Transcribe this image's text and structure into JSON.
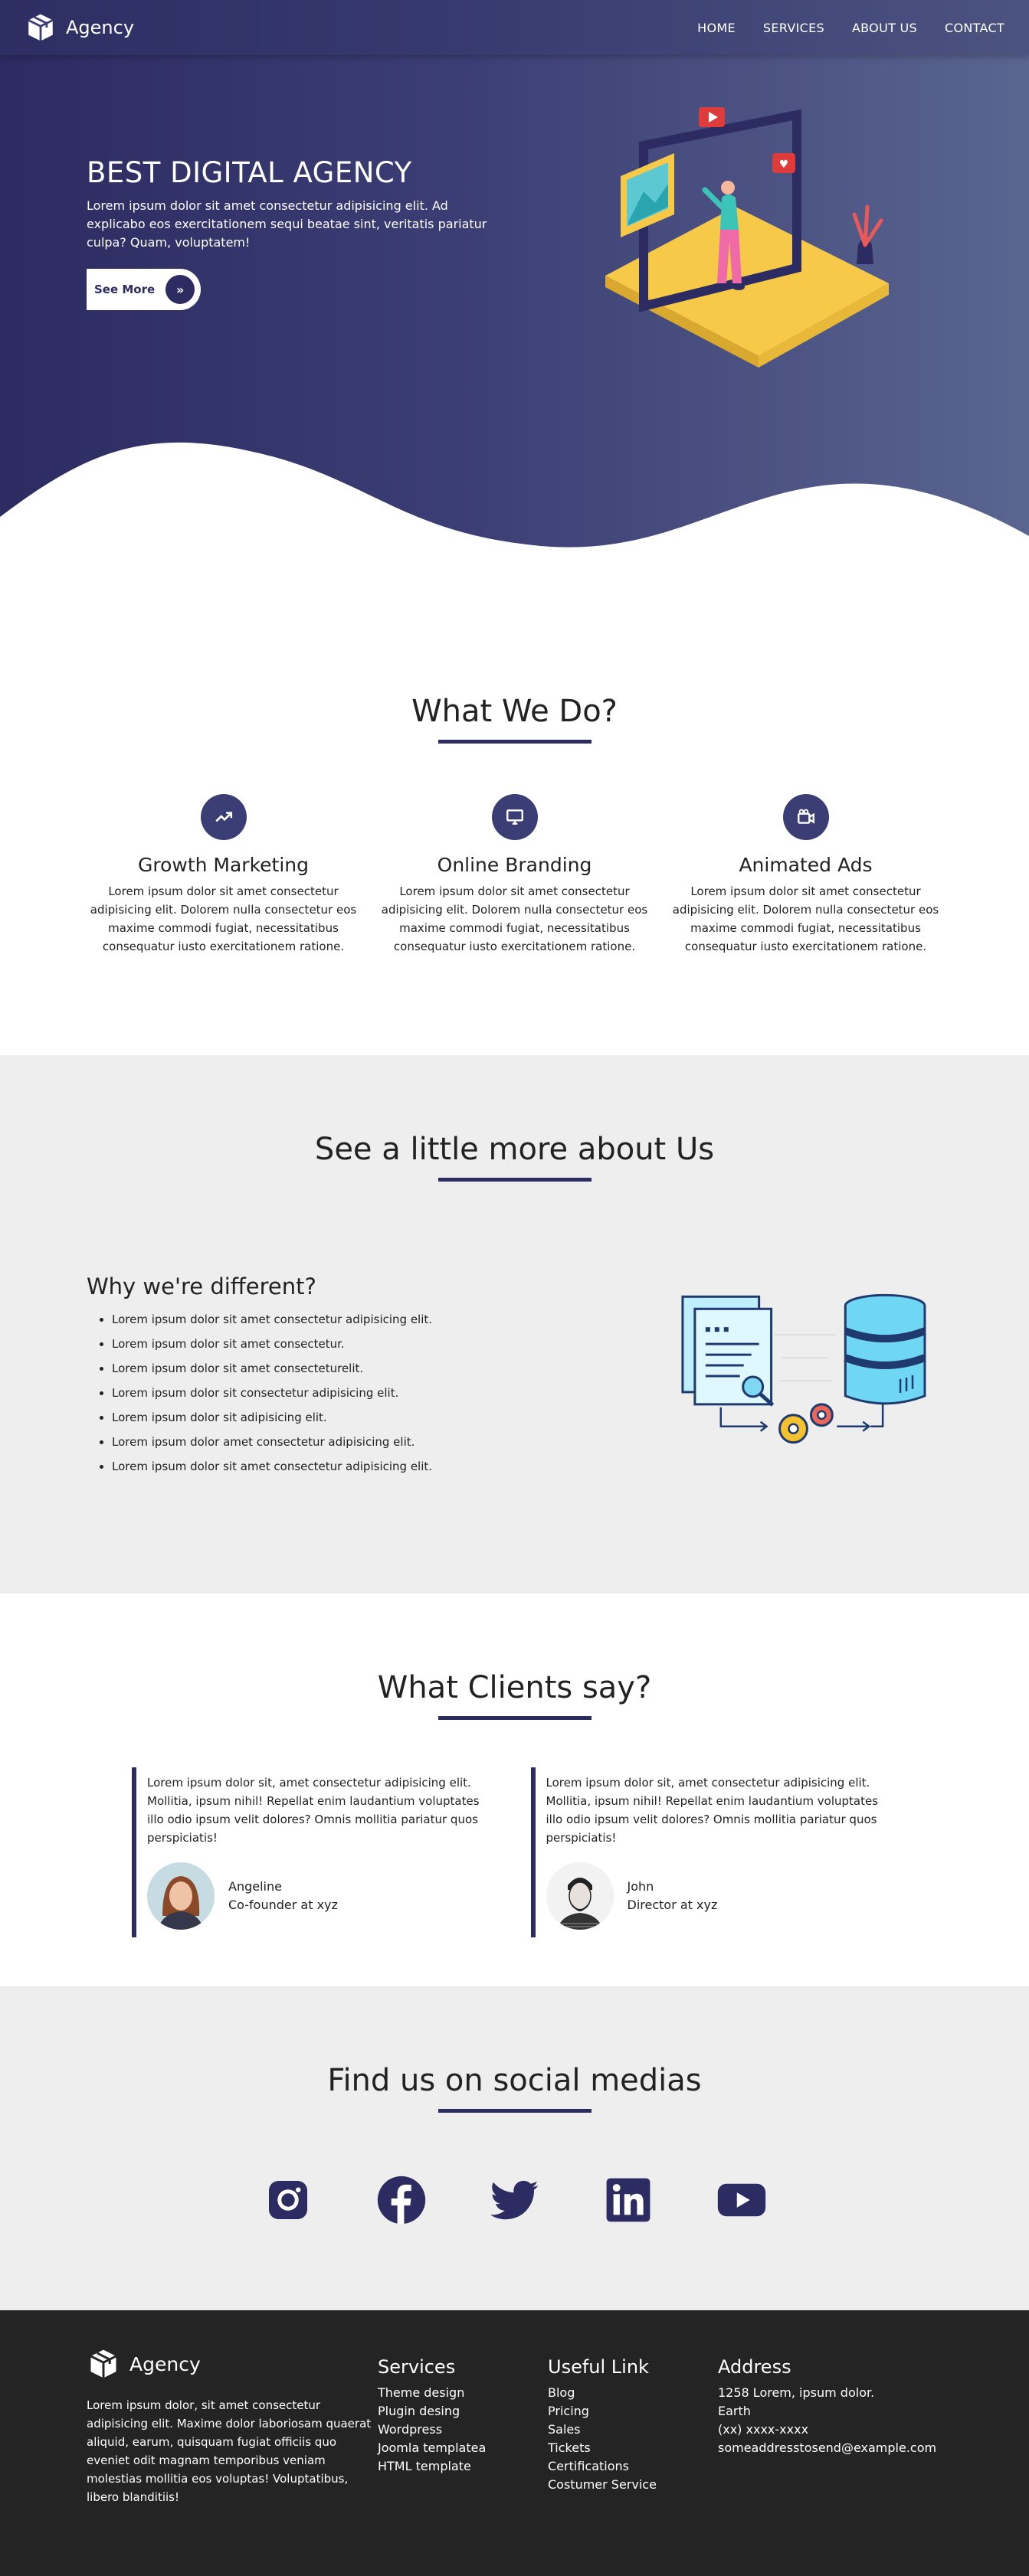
{
  "nav": {
    "brand": "Agency",
    "items": [
      "HOME",
      "SERVICES",
      "ABOUT US",
      "CONTACT"
    ]
  },
  "hero": {
    "title": "BEST DIGITAL AGENCY",
    "text": "Lorem ipsum dolor sit amet consectetur adipisicing elit. Ad explicabo eos exercitationem sequi beatae sint, veritatis pariatur culpa? Quam, voluptatem!",
    "button": "See More"
  },
  "services": {
    "title": "What We Do?",
    "items": [
      {
        "title": "Growth Marketing",
        "text": "Lorem ipsum dolor sit amet consectetur adipisicing elit. Dolorem nulla consectetur eos maxime commodi fugiat, necessitatibus consequatur iusto exercitationem ratione.",
        "icon": "trending-up-icon"
      },
      {
        "title": "Online Branding",
        "text": "Lorem ipsum dolor sit amet consectetur adipisicing elit. Dolorem nulla consectetur eos maxime commodi fugiat, necessitatibus consequatur iusto exercitationem ratione.",
        "icon": "desktop-icon"
      },
      {
        "title": "Animated Ads",
        "text": "Lorem ipsum dolor sit amet consectetur adipisicing elit. Dolorem nulla consectetur eos maxime commodi fugiat, necessitatibus consequatur iusto exercitationem ratione.",
        "icon": "video-camera-icon"
      }
    ]
  },
  "about": {
    "title": "See a little more about Us",
    "subtitle": "Why we're different?",
    "list": [
      "Lorem ipsum dolor sit amet consectetur adipisicing elit.",
      "Lorem ipsum dolor sit amet consectetur.",
      "Lorem ipsum dolor sit amet consecteturelit.",
      "Lorem ipsum dolor sit consectetur adipisicing elit.",
      "Lorem ipsum dolor sit adipisicing elit.",
      "Lorem ipsum dolor amet consectetur adipisicing elit.",
      "Lorem ipsum dolor sit amet consectetur adipisicing elit."
    ]
  },
  "clients": {
    "title": "What Clients say?",
    "items": [
      {
        "text": "Lorem ipsum dolor sit, amet consectetur adipisicing elit. Mollitia, ipsum nihil! Repellat enim laudantium voluptates illo odio ipsum velit dolores? Omnis mollitia pariatur quos perspiciatis!",
        "name": "Angeline",
        "role": "Co-founder at xyz"
      },
      {
        "text": "Lorem ipsum dolor sit, amet consectetur adipisicing elit. Mollitia, ipsum nihil! Repellat enim laudantium voluptates illo odio ipsum velit dolores? Omnis mollitia pariatur quos perspiciatis!",
        "name": "John",
        "role": "Director at xyz"
      }
    ]
  },
  "social": {
    "title": "Find us on social medias",
    "icons": [
      "instagram-icon",
      "facebook-icon",
      "twitter-icon",
      "linkedin-icon",
      "youtube-icon"
    ]
  },
  "footer": {
    "brand": "Agency",
    "about": "Lorem ipsum dolor, sit amet consectetur adipisicing elit. Maxime dolor laboriosam quaerat aliquid, earum, quisquam fugiat officiis quo eveniet odit magnam temporibus veniam molestias mollitia eos voluptas! Voluptatibus, libero blanditiis!",
    "services": {
      "title": "Services",
      "items": [
        "Theme design",
        "Plugin desing",
        "Wordpress",
        "Joomla templatea",
        "HTML template"
      ]
    },
    "links": {
      "title": "Useful Link",
      "items": [
        "Blog",
        "Pricing",
        "Sales",
        "Tickets",
        "Certifications",
        "Costumer Service"
      ]
    },
    "address": {
      "title": "Address",
      "items": [
        "1258 Lorem, ipsum dolor.",
        "Earth",
        "(xx) xxxx-xxxx",
        "someaddresstosend@example.com"
      ]
    }
  },
  "colors": {
    "primary": "#2c2b62",
    "light_bg": "#eeeeee",
    "footer_bg": "#242424"
  }
}
